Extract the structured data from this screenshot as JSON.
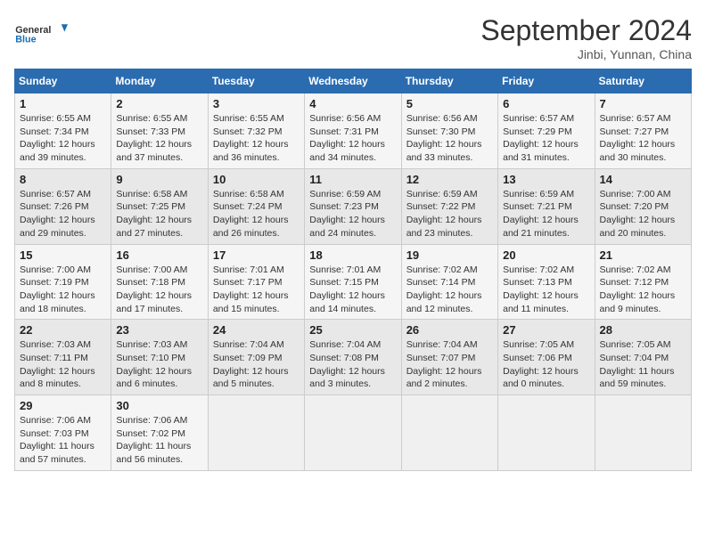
{
  "header": {
    "logo_general": "General",
    "logo_blue": "Blue",
    "title": "September 2024",
    "subtitle": "Jinbi, Yunnan, China"
  },
  "weekdays": [
    "Sunday",
    "Monday",
    "Tuesday",
    "Wednesday",
    "Thursday",
    "Friday",
    "Saturday"
  ],
  "weeks": [
    [
      {
        "day": "1",
        "info": "Sunrise: 6:55 AM\nSunset: 7:34 PM\nDaylight: 12 hours\nand 39 minutes."
      },
      {
        "day": "2",
        "info": "Sunrise: 6:55 AM\nSunset: 7:33 PM\nDaylight: 12 hours\nand 37 minutes."
      },
      {
        "day": "3",
        "info": "Sunrise: 6:55 AM\nSunset: 7:32 PM\nDaylight: 12 hours\nand 36 minutes."
      },
      {
        "day": "4",
        "info": "Sunrise: 6:56 AM\nSunset: 7:31 PM\nDaylight: 12 hours\nand 34 minutes."
      },
      {
        "day": "5",
        "info": "Sunrise: 6:56 AM\nSunset: 7:30 PM\nDaylight: 12 hours\nand 33 minutes."
      },
      {
        "day": "6",
        "info": "Sunrise: 6:57 AM\nSunset: 7:29 PM\nDaylight: 12 hours\nand 31 minutes."
      },
      {
        "day": "7",
        "info": "Sunrise: 6:57 AM\nSunset: 7:27 PM\nDaylight: 12 hours\nand 30 minutes."
      }
    ],
    [
      {
        "day": "8",
        "info": "Sunrise: 6:57 AM\nSunset: 7:26 PM\nDaylight: 12 hours\nand 29 minutes."
      },
      {
        "day": "9",
        "info": "Sunrise: 6:58 AM\nSunset: 7:25 PM\nDaylight: 12 hours\nand 27 minutes."
      },
      {
        "day": "10",
        "info": "Sunrise: 6:58 AM\nSunset: 7:24 PM\nDaylight: 12 hours\nand 26 minutes."
      },
      {
        "day": "11",
        "info": "Sunrise: 6:59 AM\nSunset: 7:23 PM\nDaylight: 12 hours\nand 24 minutes."
      },
      {
        "day": "12",
        "info": "Sunrise: 6:59 AM\nSunset: 7:22 PM\nDaylight: 12 hours\nand 23 minutes."
      },
      {
        "day": "13",
        "info": "Sunrise: 6:59 AM\nSunset: 7:21 PM\nDaylight: 12 hours\nand 21 minutes."
      },
      {
        "day": "14",
        "info": "Sunrise: 7:00 AM\nSunset: 7:20 PM\nDaylight: 12 hours\nand 20 minutes."
      }
    ],
    [
      {
        "day": "15",
        "info": "Sunrise: 7:00 AM\nSunset: 7:19 PM\nDaylight: 12 hours\nand 18 minutes."
      },
      {
        "day": "16",
        "info": "Sunrise: 7:00 AM\nSunset: 7:18 PM\nDaylight: 12 hours\nand 17 minutes."
      },
      {
        "day": "17",
        "info": "Sunrise: 7:01 AM\nSunset: 7:17 PM\nDaylight: 12 hours\nand 15 minutes."
      },
      {
        "day": "18",
        "info": "Sunrise: 7:01 AM\nSunset: 7:15 PM\nDaylight: 12 hours\nand 14 minutes."
      },
      {
        "day": "19",
        "info": "Sunrise: 7:02 AM\nSunset: 7:14 PM\nDaylight: 12 hours\nand 12 minutes."
      },
      {
        "day": "20",
        "info": "Sunrise: 7:02 AM\nSunset: 7:13 PM\nDaylight: 12 hours\nand 11 minutes."
      },
      {
        "day": "21",
        "info": "Sunrise: 7:02 AM\nSunset: 7:12 PM\nDaylight: 12 hours\nand 9 minutes."
      }
    ],
    [
      {
        "day": "22",
        "info": "Sunrise: 7:03 AM\nSunset: 7:11 PM\nDaylight: 12 hours\nand 8 minutes."
      },
      {
        "day": "23",
        "info": "Sunrise: 7:03 AM\nSunset: 7:10 PM\nDaylight: 12 hours\nand 6 minutes."
      },
      {
        "day": "24",
        "info": "Sunrise: 7:04 AM\nSunset: 7:09 PM\nDaylight: 12 hours\nand 5 minutes."
      },
      {
        "day": "25",
        "info": "Sunrise: 7:04 AM\nSunset: 7:08 PM\nDaylight: 12 hours\nand 3 minutes."
      },
      {
        "day": "26",
        "info": "Sunrise: 7:04 AM\nSunset: 7:07 PM\nDaylight: 12 hours\nand 2 minutes."
      },
      {
        "day": "27",
        "info": "Sunrise: 7:05 AM\nSunset: 7:06 PM\nDaylight: 12 hours\nand 0 minutes."
      },
      {
        "day": "28",
        "info": "Sunrise: 7:05 AM\nSunset: 7:04 PM\nDaylight: 11 hours\nand 59 minutes."
      }
    ],
    [
      {
        "day": "29",
        "info": "Sunrise: 7:06 AM\nSunset: 7:03 PM\nDaylight: 11 hours\nand 57 minutes."
      },
      {
        "day": "30",
        "info": "Sunrise: 7:06 AM\nSunset: 7:02 PM\nDaylight: 11 hours\nand 56 minutes."
      },
      {
        "day": "",
        "info": ""
      },
      {
        "day": "",
        "info": ""
      },
      {
        "day": "",
        "info": ""
      },
      {
        "day": "",
        "info": ""
      },
      {
        "day": "",
        "info": ""
      }
    ]
  ]
}
